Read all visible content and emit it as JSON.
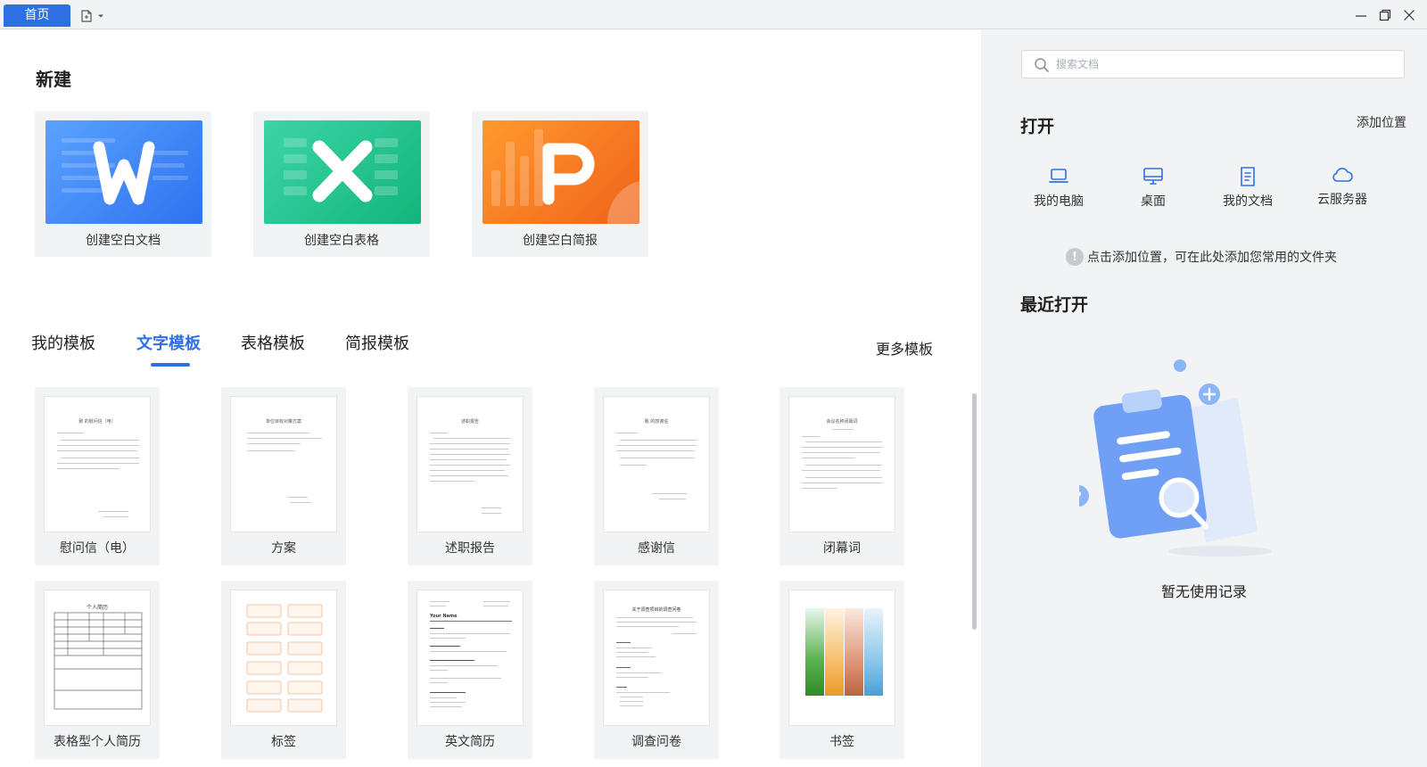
{
  "titlebar": {
    "home_tab": "首页",
    "new_tab_icon": "new-document-icon",
    "window_controls": [
      "minimize-icon",
      "restore-icon",
      "close-icon"
    ]
  },
  "new_section": {
    "title": "新建",
    "cards": [
      {
        "label": "创建空白文档",
        "icon": "writer-icon",
        "color": "#3b82f6"
      },
      {
        "label": "创建空白表格",
        "icon": "spreadsheet-icon",
        "color": "#1fb885"
      },
      {
        "label": "创建空白简报",
        "icon": "presentation-icon",
        "color": "#f26b1d"
      }
    ]
  },
  "templates": {
    "tabs": [
      "我的模板",
      "文字模板",
      "表格模板",
      "简报模板"
    ],
    "active_tab": "文字模板",
    "more": "更多模板",
    "items": [
      {
        "name": "慰问信（电）",
        "title": "致 的慰问信（电）"
      },
      {
        "name": "方案",
        "title": "单位目标对策方案"
      },
      {
        "name": "述职报告",
        "title": "述职报告"
      },
      {
        "name": "感谢信",
        "title": "致 的感谢信"
      },
      {
        "name": "闭幕词",
        "title": "会议名称闭幕词"
      },
      {
        "name": "表格型个人简历",
        "title": "个人简历"
      },
      {
        "name": "标签",
        "title": ""
      },
      {
        "name": "英文简历",
        "title": "Your Name"
      },
      {
        "name": "调查问卷",
        "title": "关于调查项目的调查问卷"
      },
      {
        "name": "书签",
        "title": ""
      }
    ]
  },
  "sidebar": {
    "search_placeholder": "搜索文档",
    "open_title": "打开",
    "add_location": "添加位置",
    "locations": [
      {
        "label": "我的电脑",
        "icon": "laptop-icon"
      },
      {
        "label": "桌面",
        "icon": "desktop-icon"
      },
      {
        "label": "我的文档",
        "icon": "document-icon"
      },
      {
        "label": "云服务器",
        "icon": "cloud-icon"
      }
    ],
    "hint": "点击添加位置，可在此处添加您常用的文件夹",
    "recent_title": "最近打开",
    "empty_text": "暂无使用记录",
    "accent": "#2f6fe4"
  }
}
